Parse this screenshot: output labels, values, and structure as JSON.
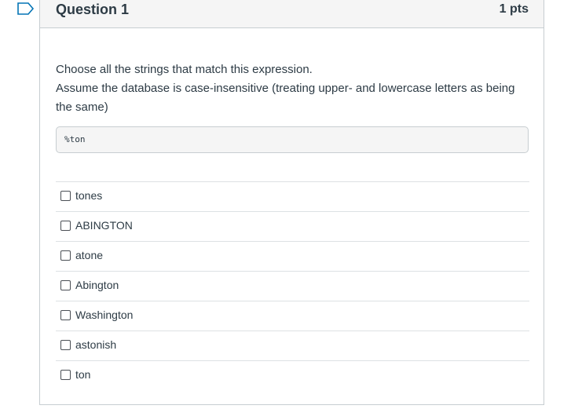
{
  "question": {
    "title": "Question 1",
    "points": "1 pts",
    "prompt_line1": "Choose all the strings that match this expression.",
    "prompt_line2": "Assume the database is case-insensitive (treating upper- and lowercase letters as being the same)",
    "expression": "%ton",
    "answers": [
      {
        "label": "tones",
        "checked": false
      },
      {
        "label": "ABINGTON",
        "checked": false
      },
      {
        "label": "atone",
        "checked": false
      },
      {
        "label": "Abington",
        "checked": false
      },
      {
        "label": "Washington",
        "checked": false
      },
      {
        "label": "astonish",
        "checked": false
      },
      {
        "label": "ton",
        "checked": false
      }
    ]
  },
  "icons": {
    "flag": "flag-icon"
  },
  "colors": {
    "flag_accent": "#0374b5",
    "text": "#2d3b45",
    "header_bg": "#f5f5f5",
    "border": "#c7cdd1"
  }
}
